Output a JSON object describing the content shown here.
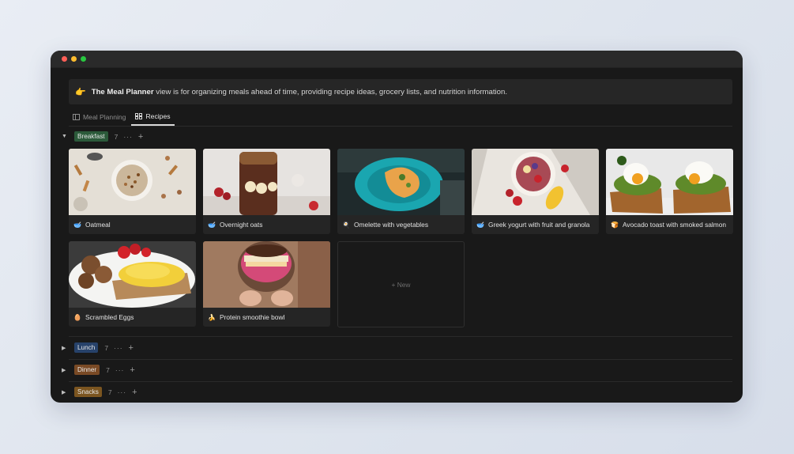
{
  "callout": {
    "emoji": "👉",
    "bold": "The Meal Planner",
    "text": " view is for organizing meals ahead of time, providing recipe ideas, grocery lists, and nutrition information."
  },
  "tabs": [
    {
      "label": "Meal Planning",
      "icon": "table-icon"
    },
    {
      "label": "Recipes",
      "icon": "gallery-icon"
    }
  ],
  "groups": {
    "breakfast": {
      "label": "Breakfast",
      "count": "7",
      "color": "#2b5a3a"
    },
    "lunch": {
      "label": "Lunch",
      "count": "7",
      "color": "#27426a"
    },
    "dinner": {
      "label": "Dinner",
      "count": "7",
      "color": "#7a4a25"
    },
    "snacks": {
      "label": "Snacks",
      "count": "7",
      "color": "#7b5520"
    }
  },
  "cards": [
    {
      "icon": "🥣",
      "title": "Oatmeal"
    },
    {
      "icon": "🥣",
      "title": "Overnight oats"
    },
    {
      "icon": "🍳",
      "title": "Omelette with vegetables"
    },
    {
      "icon": "🥣",
      "title": "Greek yogurt with fruit and granola"
    },
    {
      "icon": "🍞",
      "title": "Avocado toast with smoked salmon"
    },
    {
      "icon": "🥚",
      "title": "Scrambled Eggs"
    },
    {
      "icon": "🍌",
      "title": "Protein smoothie bowl"
    }
  ],
  "new_card": {
    "label": "+ New"
  },
  "group_actions": {
    "more": "···",
    "add": "+"
  }
}
